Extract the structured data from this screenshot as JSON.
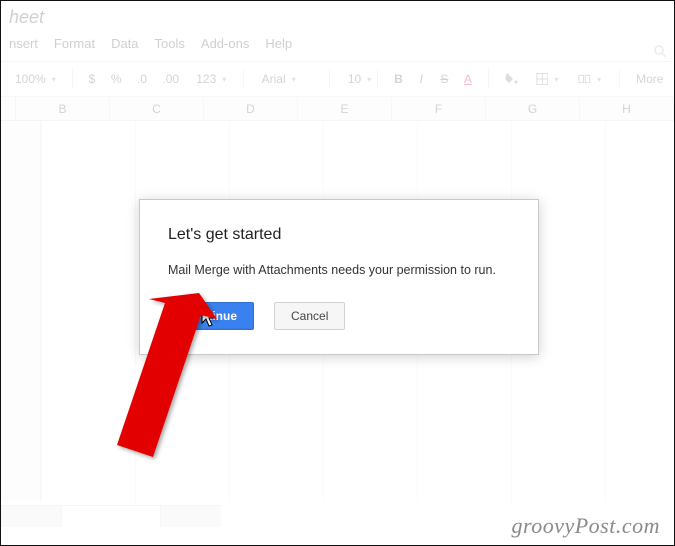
{
  "title_fragment": "heet",
  "menus": {
    "insert": "nsert",
    "format": "Format",
    "data": "Data",
    "tools": "Tools",
    "addons": "Add-ons",
    "help": "Help"
  },
  "toolbar": {
    "zoom": "100%",
    "currency": "$",
    "percent": "%",
    "dec_dec": ".0",
    "inc_dec": ".00",
    "formats": "123",
    "font": "Arial",
    "size": "10",
    "bold": "B",
    "italic": "I",
    "strike": "S",
    "more": "More"
  },
  "columns": [
    "B",
    "C",
    "D",
    "E",
    "F",
    "G",
    "H"
  ],
  "modal": {
    "title": "Let's get started",
    "body": "Mail Merge with Attachments needs your permission to run.",
    "continue": "Continue",
    "cancel": "Cancel"
  },
  "watermark": "groovyPost.com"
}
